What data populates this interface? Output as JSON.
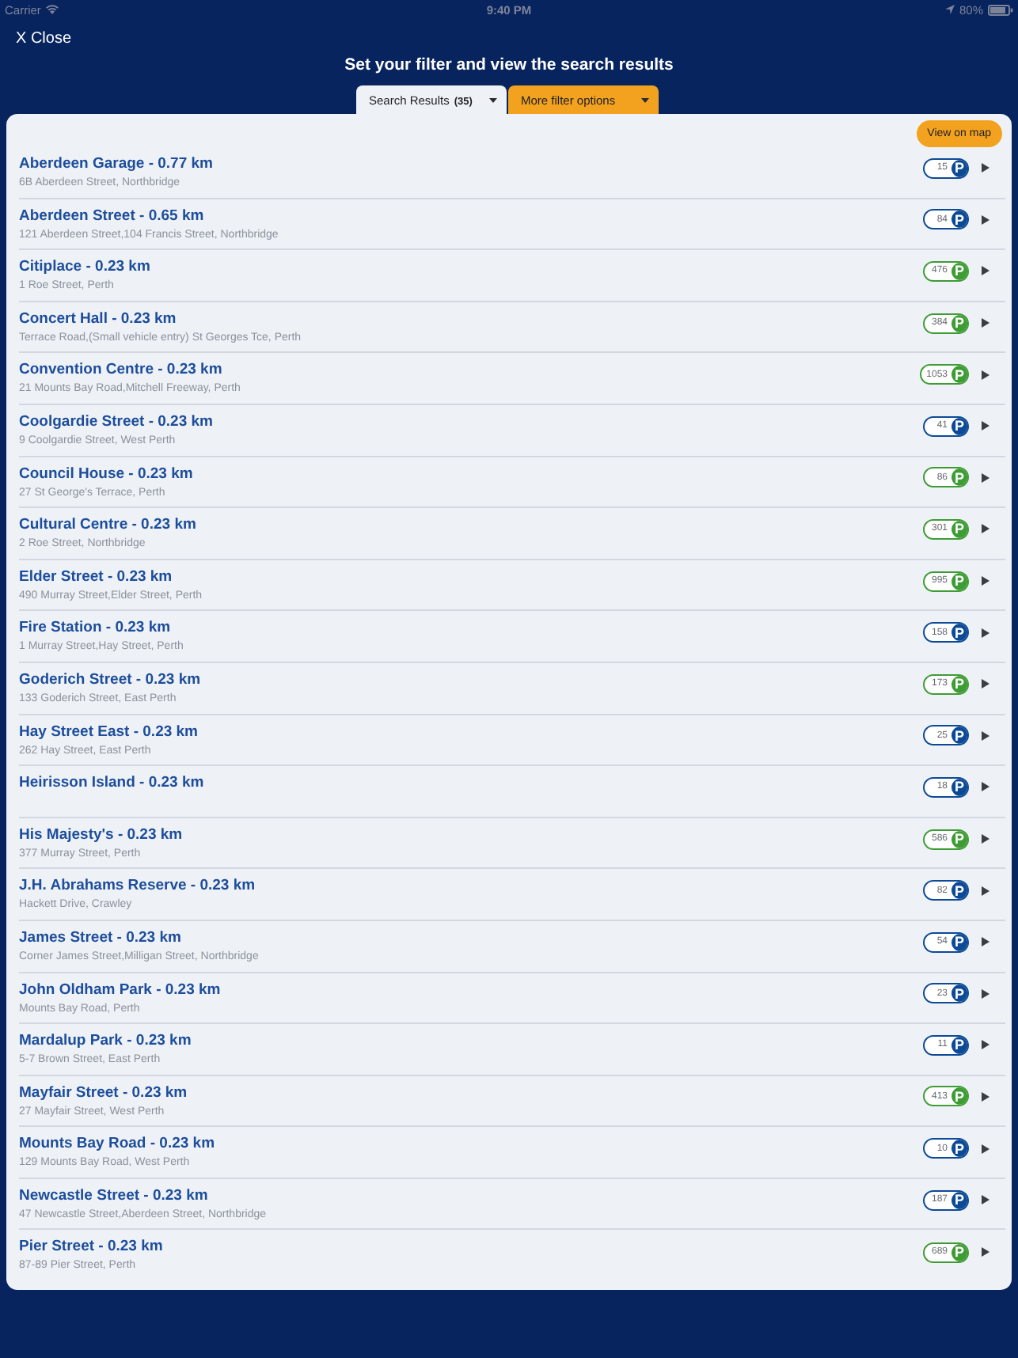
{
  "status_bar": {
    "carrier": "Carrier",
    "time": "9:40 PM",
    "battery": "80%"
  },
  "close_button": "X Close",
  "title": "Set your filter and view the search results",
  "tabs": [
    {
      "label": "Search Results",
      "count": "(35)",
      "selected": true
    },
    {
      "label": "More filter options",
      "selected": false
    }
  ],
  "map_button": "View on map",
  "rows": [
    {
      "name": "Aberdeen Garage - 0.77 km",
      "address": "6B Aberdeen Street, Northbridge",
      "spaces": "15",
      "symbol": "P",
      "color": "#0c4a96"
    },
    {
      "name": "Aberdeen Street - 0.65 km",
      "address": "121 Aberdeen Street,104 Francis Street, Northbridge",
      "spaces": "84",
      "symbol": "P",
      "color": "#0c4a96"
    },
    {
      "name": "Citiplace - 0.23 km",
      "address": "1 Roe Street, Perth",
      "spaces": "476",
      "symbol": "P",
      "color": "#3e9c34"
    },
    {
      "name": "Concert Hall - 0.23 km",
      "address": "Terrace Road,(Small vehicle entry) St Georges Tce, Perth",
      "spaces": "384",
      "symbol": "P",
      "color": "#3e9c34"
    },
    {
      "name": "Convention Centre - 0.23 km",
      "address": "21 Mounts Bay Road,Mitchell Freeway, Perth",
      "spaces": "1053",
      "symbol": "P",
      "color": "#3e9c34"
    },
    {
      "name": "Coolgardie Street - 0.23 km",
      "address": "9 Coolgardie Street, West Perth",
      "spaces": "41",
      "symbol": "P",
      "color": "#0c4a96"
    },
    {
      "name": "Council House - 0.23 km",
      "address": "27 St George's Terrace, Perth",
      "spaces": "86",
      "symbol": "P",
      "color": "#3e9c34"
    },
    {
      "name": "Cultural Centre - 0.23 km",
      "address": "2 Roe Street, Northbridge",
      "spaces": "301",
      "symbol": "P",
      "color": "#3e9c34"
    },
    {
      "name": "Elder Street - 0.23 km",
      "address": "490 Murray Street,Elder Street, Perth",
      "spaces": "995",
      "symbol": "P",
      "color": "#3e9c34"
    },
    {
      "name": "Fire Station - 0.23 km",
      "address": "1 Murray Street,Hay Street, Perth",
      "spaces": "158",
      "symbol": "P",
      "color": "#0c4a96"
    },
    {
      "name": "Goderich Street - 0.23 km",
      "address": "133 Goderich Street, East Perth",
      "spaces": "173",
      "symbol": "P",
      "color": "#3e9c34"
    },
    {
      "name": "Hay Street East - 0.23 km",
      "address": "262 Hay Street, East Perth",
      "spaces": "25",
      "symbol": "P",
      "color": "#0c4a96"
    },
    {
      "name": "Heirisson Island - 0.23 km",
      "spaces": "18",
      "symbol": "P",
      "color": "#0c4a96"
    },
    {
      "name": "His Majesty's - 0.23 km",
      "address": "377 Murray Street, Perth",
      "spaces": "586",
      "symbol": "P",
      "color": "#3e9c34"
    },
    {
      "name": "J.H. Abrahams Reserve - 0.23 km",
      "address": "Hackett Drive, Crawley",
      "spaces": "82",
      "symbol": "P",
      "color": "#0c4a96"
    },
    {
      "name": "James Street - 0.23 km",
      "address": "Corner James Street,Milligan Street, Northbridge",
      "spaces": "54",
      "symbol": "P",
      "color": "#0c4a96"
    },
    {
      "name": "John Oldham Park - 0.23 km",
      "address": "Mounts Bay Road, Perth",
      "spaces": "23",
      "symbol": "P",
      "color": "#0c4a96"
    },
    {
      "name": "Mardalup Park - 0.23 km",
      "address": "5-7 Brown Street, East Perth",
      "spaces": "11",
      "symbol": "P",
      "color": "#0c4a96"
    },
    {
      "name": "Mayfair Street - 0.23 km",
      "address": "27 Mayfair Street, West Perth",
      "spaces": "413",
      "symbol": "P",
      "color": "#3e9c34"
    },
    {
      "name": "Mounts Bay Road - 0.23 km",
      "address": "129 Mounts Bay Road, West Perth",
      "spaces": "10",
      "symbol": "P",
      "color": "#0c4a96"
    },
    {
      "name": "Newcastle Street - 0.23 km",
      "address": "47 Newcastle Street,Aberdeen Street, Northbridge",
      "spaces": "187",
      "symbol": "P",
      "color": "#0c4a96"
    },
    {
      "name": "Pier Street - 0.23 km",
      "address": "87-89 Pier Street, Perth",
      "spaces": "689",
      "symbol": "P",
      "color": "#3e9c34"
    }
  ]
}
